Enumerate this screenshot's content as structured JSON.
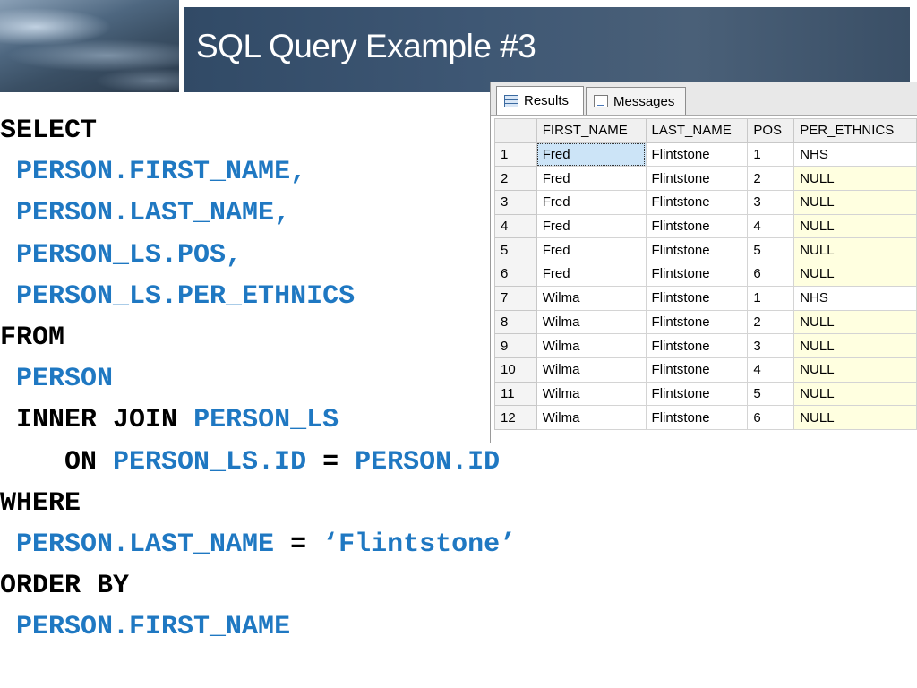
{
  "slide": {
    "title": "SQL Query Example #3"
  },
  "code_lines": [
    {
      "indent": "",
      "parts": [
        {
          "t": "SELECT",
          "c": "kw"
        }
      ]
    },
    {
      "indent": " ",
      "parts": [
        {
          "t": "PERSON.FIRST_NAME,",
          "c": "id"
        }
      ]
    },
    {
      "indent": " ",
      "parts": [
        {
          "t": "PERSON.LAST_NAME,",
          "c": "id"
        }
      ]
    },
    {
      "indent": " ",
      "parts": [
        {
          "t": "PERSON_LS.POS,",
          "c": "id"
        }
      ]
    },
    {
      "indent": " ",
      "parts": [
        {
          "t": "PERSON_LS.PER_ETHNICS",
          "c": "id"
        }
      ]
    },
    {
      "indent": "",
      "parts": [
        {
          "t": "FROM",
          "c": "kw"
        }
      ]
    },
    {
      "indent": " ",
      "parts": [
        {
          "t": "PERSON",
          "c": "id"
        }
      ]
    },
    {
      "indent": " ",
      "parts": [
        {
          "t": "INNER JOIN ",
          "c": "kw"
        },
        {
          "t": "PERSON_LS",
          "c": "id"
        }
      ]
    },
    {
      "indent": "    ",
      "parts": [
        {
          "t": "ON ",
          "c": "kw"
        },
        {
          "t": "PERSON_LS.ID",
          "c": "id"
        },
        {
          "t": " = ",
          "c": "kw"
        },
        {
          "t": "PERSON.ID",
          "c": "id"
        }
      ]
    },
    {
      "indent": "",
      "parts": [
        {
          "t": "WHERE",
          "c": "kw"
        }
      ]
    },
    {
      "indent": " ",
      "parts": [
        {
          "t": "PERSON.LAST_NAME",
          "c": "id"
        },
        {
          "t": " = ",
          "c": "kw"
        },
        {
          "t": "‘Flintstone’",
          "c": "id"
        }
      ]
    },
    {
      "indent": "",
      "parts": [
        {
          "t": "ORDER BY",
          "c": "kw"
        }
      ]
    },
    {
      "indent": " ",
      "parts": [
        {
          "t": "PERSON.FIRST_NAME",
          "c": "id"
        }
      ]
    }
  ],
  "results_window": {
    "tabs": [
      {
        "label": "Results",
        "icon": "results-grid-icon",
        "active": true
      },
      {
        "label": "Messages",
        "icon": "messages-icon",
        "active": false
      }
    ],
    "columns": [
      "",
      "FIRST_NAME",
      "LAST_NAME",
      "POS",
      "PER_ETHNICS"
    ],
    "rows": [
      [
        "1",
        "Fred",
        "Flintstone",
        "1",
        "NHS"
      ],
      [
        "2",
        "Fred",
        "Flintstone",
        "2",
        "NULL"
      ],
      [
        "3",
        "Fred",
        "Flintstone",
        "3",
        "NULL"
      ],
      [
        "4",
        "Fred",
        "Flintstone",
        "4",
        "NULL"
      ],
      [
        "5",
        "Fred",
        "Flintstone",
        "5",
        "NULL"
      ],
      [
        "6",
        "Fred",
        "Flintstone",
        "6",
        "NULL"
      ],
      [
        "7",
        "Wilma",
        "Flintstone",
        "1",
        "NHS"
      ],
      [
        "8",
        "Wilma",
        "Flintstone",
        "2",
        "NULL"
      ],
      [
        "9",
        "Wilma",
        "Flintstone",
        "3",
        "NULL"
      ],
      [
        "10",
        "Wilma",
        "Flintstone",
        "4",
        "NULL"
      ],
      [
        "11",
        "Wilma",
        "Flintstone",
        "5",
        "NULL"
      ],
      [
        "12",
        "Wilma",
        "Flintstone",
        "6",
        "NULL"
      ]
    ],
    "selected_cell": {
      "row": 0,
      "col": 1
    },
    "null_cell_color": "#ffffe0"
  },
  "colors": {
    "keyword": "#000000",
    "identifier": "#1f78c2",
    "title_bar": "#3e5774"
  }
}
